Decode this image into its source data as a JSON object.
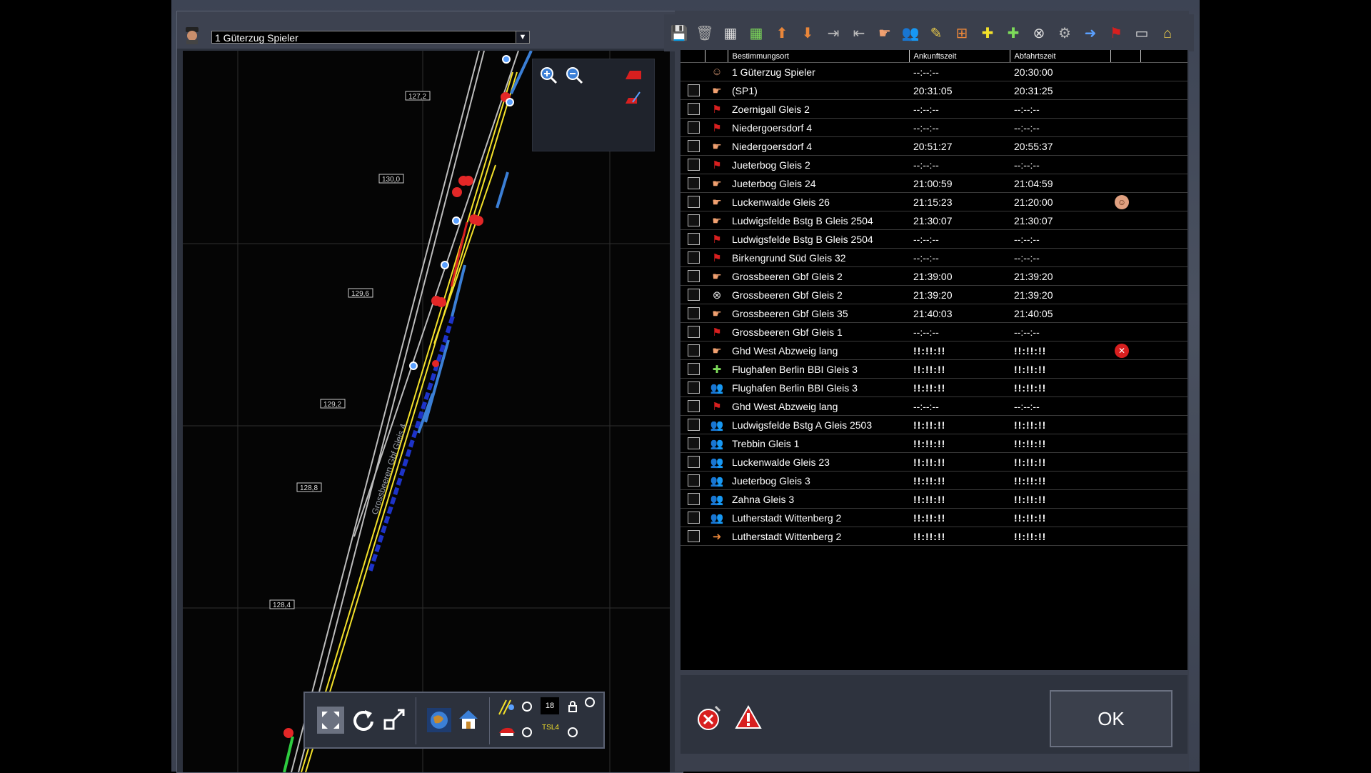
{
  "train_selector": {
    "value": "1 Güterzug Spieler"
  },
  "map": {
    "km_labels": [
      "127,2",
      "130,0",
      "129,6",
      "129,2",
      "128,8",
      "128,4"
    ],
    "track_label": "Grossbeeren Gbf Gleis 4"
  },
  "timetable": {
    "columns": {
      "destination": "Bestimmungsort",
      "arrival": "Ankunftszeit",
      "departure": "Abfahrtszeit"
    },
    "rows": [
      {
        "icon": "driver-icon",
        "destination": "1 Güterzug Spieler",
        "arrival": "--:--:--",
        "departure": "20:30:00",
        "checkbox": false
      },
      {
        "icon": "hand-pointer-icon",
        "destination": "(SP1)",
        "arrival": "20:31:05",
        "departure": "20:31:25",
        "checkbox": true
      },
      {
        "icon": "red-flag-icon",
        "destination": "Zoernigall Gleis 2",
        "arrival": "--:--:--",
        "departure": "--:--:--",
        "checkbox": true
      },
      {
        "icon": "red-flag-icon",
        "destination": "Niedergoersdorf 4",
        "arrival": "--:--:--",
        "departure": "--:--:--",
        "checkbox": true
      },
      {
        "icon": "hand-pointer-icon",
        "destination": "Niedergoersdorf 4",
        "arrival": "20:51:27",
        "departure": "20:55:37",
        "checkbox": true
      },
      {
        "icon": "red-flag-icon",
        "destination": "Jueterbog Gleis 2",
        "arrival": "--:--:--",
        "departure": "--:--:--",
        "checkbox": true
      },
      {
        "icon": "hand-pointer-icon",
        "destination": "Jueterbog Gleis 24",
        "arrival": "21:00:59",
        "departure": "21:04:59",
        "checkbox": true
      },
      {
        "icon": "hand-pointer-icon",
        "destination": "Luckenwalde Gleis 26",
        "arrival": "21:15:23",
        "departure": "21:20:00",
        "checkbox": true,
        "extra": "driver-face-icon"
      },
      {
        "icon": "hand-pointer-icon",
        "destination": "Ludwigsfelde Bstg B Gleis 2504",
        "arrival": "21:30:07",
        "departure": "21:30:07",
        "checkbox": true
      },
      {
        "icon": "red-flag-icon",
        "destination": "Ludwigsfelde Bstg B Gleis 2504",
        "arrival": "--:--:--",
        "departure": "--:--:--",
        "checkbox": true
      },
      {
        "icon": "red-flag-icon",
        "destination": "Birkengrund Süd Gleis 32",
        "arrival": "--:--:--",
        "departure": "--:--:--",
        "checkbox": true
      },
      {
        "icon": "hand-pointer-icon",
        "destination": "Grossbeeren Gbf Gleis 2",
        "arrival": "21:39:00",
        "departure": "21:39:20",
        "checkbox": true
      },
      {
        "icon": "search-remove-icon",
        "destination": "Grossbeeren Gbf Gleis 2",
        "arrival": "21:39:20",
        "departure": "21:39:20",
        "checkbox": true
      },
      {
        "icon": "hand-pointer-icon",
        "destination": "Grossbeeren Gbf Gleis 35",
        "arrival": "21:40:03",
        "departure": "21:40:05",
        "checkbox": true
      },
      {
        "icon": "red-flag-icon",
        "destination": "Grossbeeren Gbf Gleis 1",
        "arrival": "--:--:--",
        "departure": "--:--:--",
        "checkbox": true
      },
      {
        "icon": "hand-pointer-icon",
        "destination": "Ghd West Abzweig lang",
        "arrival": "!!:!!:!!",
        "departure": "!!:!!:!!",
        "checkbox": true,
        "extra": "remove-x-icon"
      },
      {
        "icon": "add-green-icon",
        "destination": "Flughafen Berlin BBI Gleis 3",
        "arrival": "!!:!!:!!",
        "departure": "!!:!!:!!",
        "checkbox": true
      },
      {
        "icon": "passengers-icon",
        "destination": "Flughafen Berlin BBI Gleis 3",
        "arrival": "!!:!!:!!",
        "departure": "!!:!!:!!",
        "checkbox": true
      },
      {
        "icon": "red-flag-icon",
        "destination": "Ghd West Abzweig lang",
        "arrival": "--:--:--",
        "departure": "--:--:--",
        "checkbox": true
      },
      {
        "icon": "passengers-icon",
        "destination": "Ludwigsfelde Bstg A Gleis 2503",
        "arrival": "!!:!!:!!",
        "departure": "!!:!!:!!",
        "checkbox": true
      },
      {
        "icon": "passengers-icon",
        "destination": "Trebbin Gleis 1",
        "arrival": "!!:!!:!!",
        "departure": "!!:!!:!!",
        "checkbox": true
      },
      {
        "icon": "passengers-icon",
        "destination": "Luckenwalde Gleis 23",
        "arrival": "!!:!!:!!",
        "departure": "!!:!!:!!",
        "checkbox": true
      },
      {
        "icon": "passengers-icon",
        "destination": "Jueterbog Gleis 3",
        "arrival": "!!:!!:!!",
        "departure": "!!:!!:!!",
        "checkbox": true
      },
      {
        "icon": "passengers-icon",
        "destination": "Zahna Gleis 3",
        "arrival": "!!:!!:!!",
        "departure": "!!:!!:!!",
        "checkbox": true
      },
      {
        "icon": "passengers-icon",
        "destination": "Lutherstadt Wittenberg 2",
        "arrival": "!!:!!:!!",
        "departure": "!!:!!:!!",
        "checkbox": true
      },
      {
        "icon": "transfer-arrow-icon",
        "destination": "Lutherstadt Wittenberg 2",
        "arrival": "!!:!!:!!",
        "departure": "!!:!!:!!",
        "checkbox": true
      }
    ]
  },
  "map_toolbar": {
    "counter_value": "18",
    "tsl_label": "TSL4"
  },
  "ok_button": "OK",
  "colors": {
    "invalid_time": "#e02424",
    "flag": "#d81f1f",
    "hand": "#f0a070",
    "track_yellow": "#f3e12a",
    "track_blue": "#3b7fd6"
  }
}
